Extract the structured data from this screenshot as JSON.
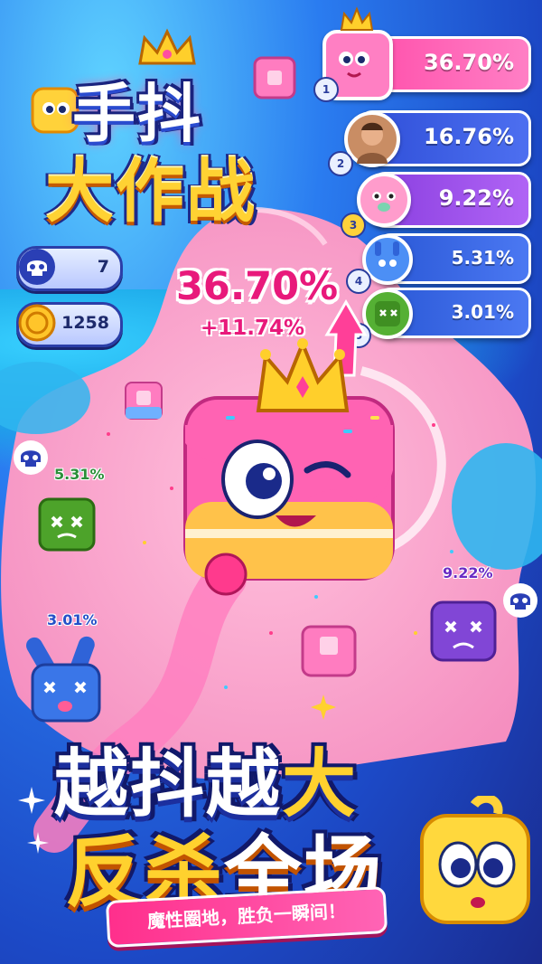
{
  "game": {
    "title_line1": "手抖",
    "title_line2": "大作战"
  },
  "stats": {
    "kills": "7",
    "coins": "1258"
  },
  "leaderboard": [
    {
      "rank": "1",
      "percent": "36.70%",
      "color": "#ff5bb0",
      "avatar": "pink-cake-crowned"
    },
    {
      "rank": "2",
      "percent": "16.76%",
      "color": "#3a5fe0",
      "avatar": "player-photo"
    },
    {
      "rank": "3",
      "percent": "9.22%",
      "color": "#9b49e8",
      "avatar": "pink-bear"
    },
    {
      "rank": "4",
      "percent": "5.31%",
      "color": "#2f6fe4",
      "avatar": "blue-bunny"
    },
    {
      "rank": "5",
      "percent": "3.01%",
      "color": "#2f6fe4",
      "avatar": "green-block"
    }
  ],
  "player": {
    "percent": "36.70%",
    "gain": "+11.74%"
  },
  "opponents": {
    "green": "5.31%",
    "purple": "9.22%",
    "blue": "3.01%"
  },
  "slogan": {
    "line1_a": "越抖越",
    "line1_b": "大",
    "line2_a": "反杀",
    "line2_b": "全场",
    "tagline": "魔性圈地，胜负一瞬间！"
  }
}
